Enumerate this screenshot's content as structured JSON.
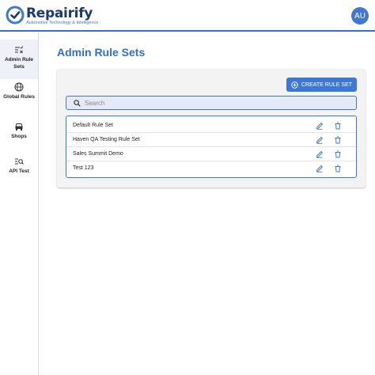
{
  "header": {
    "brand": "Repairify",
    "tagline": "Automotive Technology & Intelligence",
    "avatar_initials": "AU",
    "accent_color": "#2f6fcf"
  },
  "sidebar": {
    "items": [
      {
        "label": "Admin Rule Sets",
        "icon": "tune-check-icon",
        "active": true
      },
      {
        "label": "Global Rules",
        "icon": "globe-icon",
        "active": false
      },
      {
        "label": "Shops",
        "icon": "car-icon",
        "active": false
      },
      {
        "label": "API Test",
        "icon": "list-search-icon",
        "active": false
      }
    ]
  },
  "main": {
    "title": "Admin Rule Sets",
    "create_button_label": "CREATE RULE SET",
    "search_placeholder": "Search",
    "rule_sets": [
      {
        "name": "Default Rule Set"
      },
      {
        "name": "Haven QA Testing Rule Set"
      },
      {
        "name": "Sales Summit Demo"
      },
      {
        "name": "Test 123"
      }
    ]
  }
}
